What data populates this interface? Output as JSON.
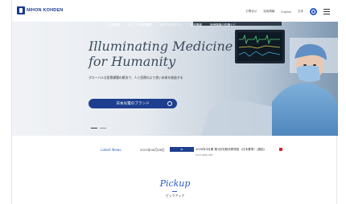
{
  "brand": {
    "logo_text": "NIHON KOHDEN"
  },
  "utility_nav": [
    "お問合せ",
    "採用情報",
    "English",
    "日本"
  ],
  "main_nav": [
    "企業情報",
    "株主・投資家情報",
    "サステナビリティ",
    "採用情報",
    "医療機器の知識ナビ"
  ],
  "hero": {
    "headline_line1": "Illuminating Medicine",
    "headline_line2": "for Humanity",
    "subcopy": "グローバルな医療課題の解決で、人と医療のより良い未来を創造する",
    "cta_label": "日本光電のブランド"
  },
  "news": {
    "label": "Latest News",
    "date": "2025年08月08日",
    "badge": "IR",
    "title": "2026年3月期 第1四半期決算短信〔日本基準〕(連結)",
    "sub": "(573.8KB)  PDF"
  },
  "pickup": {
    "title": "Pickup",
    "subtitle": "ピックアップ"
  },
  "colors": {
    "brand_blue": "#1e3f8f",
    "link_blue": "#2a59c9"
  }
}
